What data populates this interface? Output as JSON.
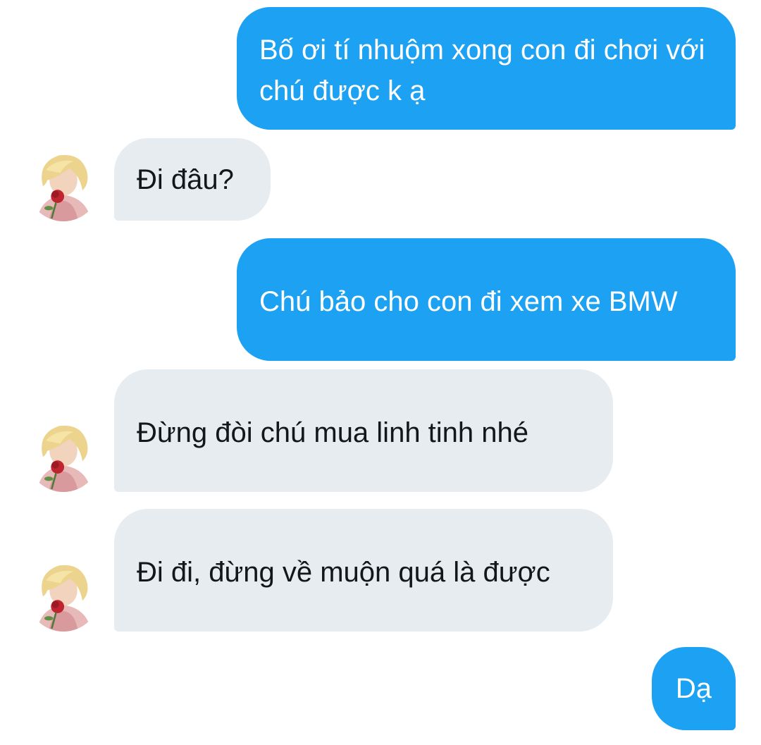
{
  "messages": [
    {
      "from": "me",
      "text": "Bố ơi tí nhuộm xong con đi chơi với chú được k ạ"
    },
    {
      "from": "other",
      "text": "Đi đâu?"
    },
    {
      "from": "me",
      "text": "Chú bảo cho con đi xem xe BMW"
    },
    {
      "from": "other",
      "text": "Đừng đòi chú mua linh tinh nhé"
    },
    {
      "from": "other",
      "text": "Đi đi, đừng về muộn quá là được"
    },
    {
      "from": "me",
      "text": "Dạ"
    }
  ],
  "colors": {
    "sent_bubble": "#1da1f2",
    "received_bubble": "#e7ecf0",
    "sent_text": "#ffffff",
    "received_text": "#14171a"
  },
  "icons": {
    "avatar": "profile-photo-blonde-hair-red-rose"
  }
}
